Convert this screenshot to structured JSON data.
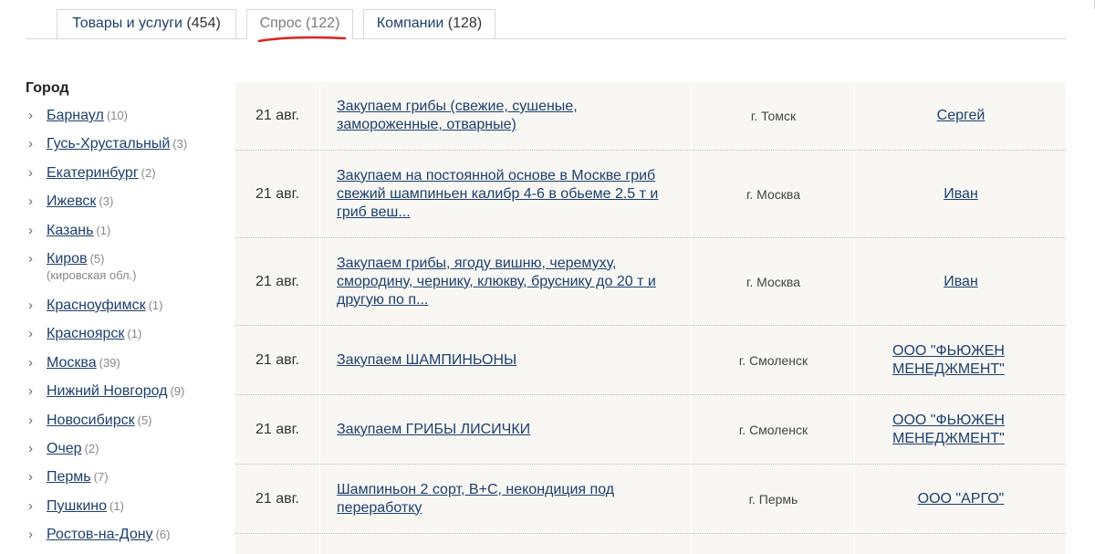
{
  "tabs": [
    {
      "label": "Товары и услуги",
      "count": "(454)"
    },
    {
      "label": "Спрос",
      "count": "(122)"
    },
    {
      "label": "Компании",
      "count": "(128)"
    }
  ],
  "sidebar": {
    "title": "Город",
    "cities": [
      {
        "name": "Барнаул",
        "count": "(10)"
      },
      {
        "name": "Гусь-Хрустальный",
        "count": "(3)"
      },
      {
        "name": "Екатеринбург",
        "count": "(2)"
      },
      {
        "name": "Ижевск",
        "count": "(3)"
      },
      {
        "name": "Казань",
        "count": "(1)"
      },
      {
        "name": "Киров",
        "count": "(5)",
        "region": "(кировская обл.)"
      },
      {
        "name": "Красноуфимск",
        "count": "(1)"
      },
      {
        "name": "Красноярск",
        "count": "(1)"
      },
      {
        "name": "Москва",
        "count": "(39)"
      },
      {
        "name": "Нижний Новгород",
        "count": "(9)"
      },
      {
        "name": "Новосибирск",
        "count": "(5)"
      },
      {
        "name": "Очер",
        "count": "(2)"
      },
      {
        "name": "Пермь",
        "count": "(7)"
      },
      {
        "name": "Пушкино",
        "count": "(1)"
      },
      {
        "name": "Ростов-на-Дону",
        "count": "(6)"
      }
    ]
  },
  "rows": [
    {
      "date": "21 авг.",
      "title": "Закупаем грибы (свежие, сушеные, замороженные, отварные)",
      "city": "г. Томск",
      "author": "Сергей"
    },
    {
      "date": "21 авг.",
      "title": "Закупаем на постоянной основе в Москве гриб свежий шампиньен калибр 4-6 в обьеме 2.5 т и гриб веш...",
      "city": "г. Москва",
      "author": "Иван"
    },
    {
      "date": "21 авг.",
      "title": "Закупаем грибы, ягоду вишню, черемуху, смородину, чернику, клюкву, бруснику до 20 т и другую по п...",
      "city": "г. Москва",
      "author": "Иван"
    },
    {
      "date": "21 авг.",
      "title": "Закупаем ШАМПИНЬОНЫ",
      "city": "г. Смоленск",
      "author": "ООО \"ФЬЮЖЕН МЕНЕДЖМЕНТ\""
    },
    {
      "date": "21 авг.",
      "title": "Закупаем ГРИБЫ ЛИСИЧКИ",
      "city": "г. Смоленск",
      "author": "ООО \"ФЬЮЖЕН МЕНЕДЖМЕНТ\""
    },
    {
      "date": "21 авг.",
      "title": "Шампиньон 2 сорт, В+С, некондиция под переработку",
      "city": "г. Пермь",
      "author": "ООО \"АРГО\""
    }
  ],
  "colors": {
    "link": "#1e3f6e",
    "row_bg": "#f8f7f4",
    "annotation": "#e02020"
  }
}
